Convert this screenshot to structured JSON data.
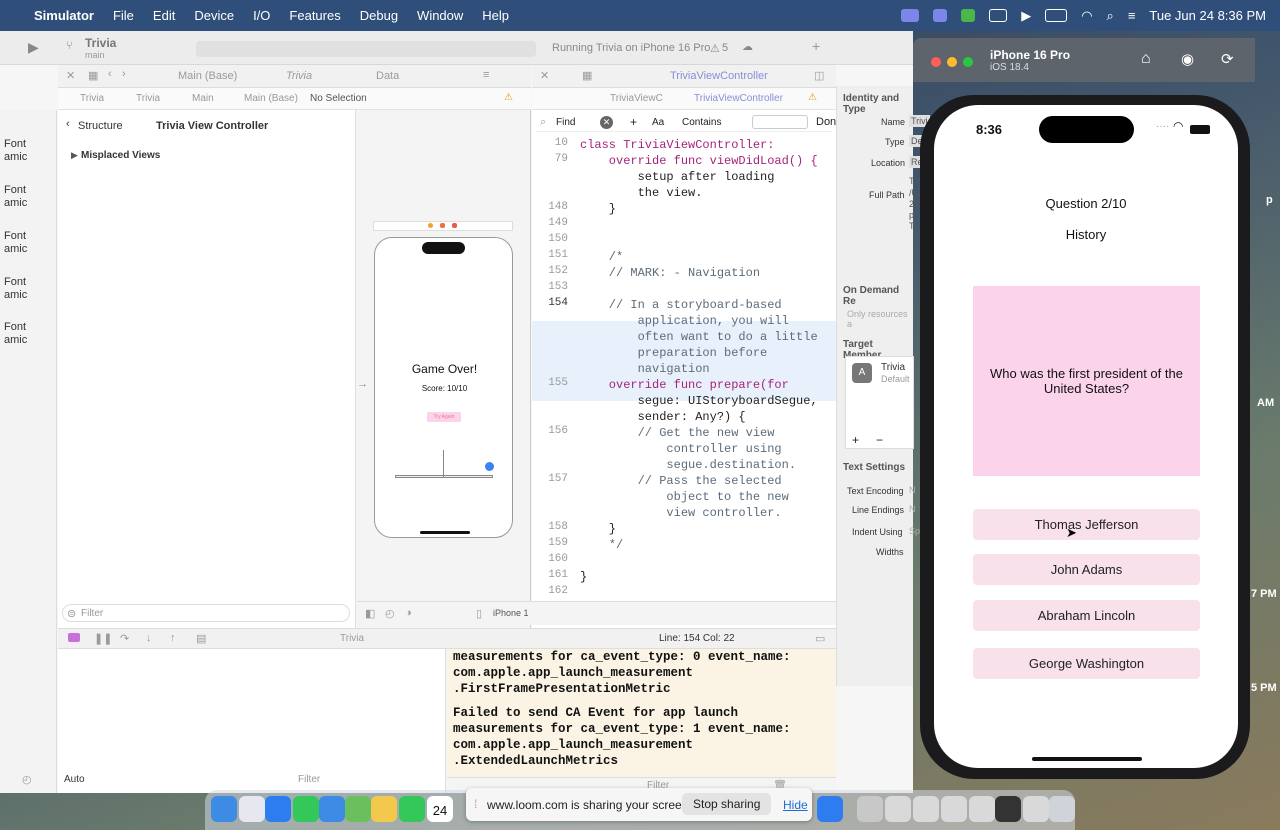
{
  "menubar": {
    "app": "Simulator",
    "items": [
      "File",
      "Edit",
      "Device",
      "I/O",
      "Features",
      "Debug",
      "Window",
      "Help"
    ],
    "datetime": "Tue Jun 24  8:36 PM"
  },
  "xcode": {
    "project": "Trivia",
    "branch": "main",
    "status": "Running Trivia on iPhone 16 Pro",
    "warnings": "5",
    "tabs_left": [
      "Main (Base)",
      "Trivia",
      "Data"
    ],
    "tab_right": "TriviaViewController",
    "jump_left": [
      "Trivia",
      "Trivia",
      "Main",
      "Main (Base)",
      "No Selection"
    ],
    "jump_right": [
      "TriviaViewC",
      "TriviaViewController"
    ],
    "outline_back": "Structure",
    "outline_title": "Trivia View Controller",
    "outline_item": "Misplaced Views",
    "filter_placeholder": "Filter",
    "font_labels": [
      {
        "l1": "Font",
        "l2": "amic"
      },
      {
        "l1": "Font",
        "l2": "amic"
      },
      {
        "l1": "Font",
        "l2": "amic"
      },
      {
        "l1": "Font",
        "l2": "amic"
      },
      {
        "l1": "Font",
        "l2": "amic"
      }
    ],
    "canvas": {
      "title": "Game Over!",
      "score": "Score: 10/10",
      "button": "Try Again",
      "device": "iPhone 1"
    },
    "find": {
      "label": "Find",
      "mode": "Contains",
      "done": "Don",
      "aa": "Aa"
    },
    "code_lines": [
      {
        "num": "10",
        "text": "class TriviaViewController:"
      },
      {
        "num": "79",
        "text": "    override func viewDidLoad() {"
      },
      {
        "num": "",
        "text": "        setup after loading"
      },
      {
        "num": "",
        "text": "        the view."
      },
      {
        "num": "148",
        "text": "    }"
      },
      {
        "num": "149",
        "text": ""
      },
      {
        "num": "150",
        "text": ""
      },
      {
        "num": "151",
        "text": "    /*"
      },
      {
        "num": "152",
        "text": "    // MARK: - Navigation"
      },
      {
        "num": "153",
        "text": ""
      },
      {
        "num": "154",
        "text": "    // In a storyboard-based"
      },
      {
        "num": "",
        "text": "        application, you will"
      },
      {
        "num": "",
        "text": "        often want to do a little"
      },
      {
        "num": "",
        "text": "        preparation before"
      },
      {
        "num": "",
        "text": "        navigation"
      },
      {
        "num": "155",
        "text": "    override func prepare(for"
      },
      {
        "num": "",
        "text": "        segue: UIStoryboardSegue,"
      },
      {
        "num": "",
        "text": "        sender: Any?) {"
      },
      {
        "num": "156",
        "text": "        // Get the new view"
      },
      {
        "num": "",
        "text": "            controller using"
      },
      {
        "num": "",
        "text": "            segue.destination."
      },
      {
        "num": "157",
        "text": "        // Pass the selected"
      },
      {
        "num": "",
        "text": "            object to the new"
      },
      {
        "num": "",
        "text": "            view controller."
      },
      {
        "num": "158",
        "text": "    }"
      },
      {
        "num": "159",
        "text": "    */"
      },
      {
        "num": "160",
        "text": ""
      },
      {
        "num": "161",
        "text": "}"
      },
      {
        "num": "162",
        "text": ""
      }
    ],
    "cursor": "Line: 154  Col: 22",
    "console_lines": [
      "measurements for ca_event_type: 0 event_name:",
      "com.apple.app_launch_measurement",
      ".FirstFramePresentationMetric",
      "",
      "Failed to send CA Event for app launch",
      "measurements for ca_event_type: 1 event_name:",
      "com.apple.app_launch_measurement",
      ".ExtendedLaunchMetrics"
    ],
    "debug_scheme": "Trivia",
    "vars_mode": "Auto",
    "inspector": {
      "header": "Identity and Type",
      "rows": [
        {
          "label": "Name",
          "value": "Trivi"
        },
        {
          "label": "Type",
          "value": "De"
        },
        {
          "label": "Location",
          "value": "Re"
        },
        {
          "label": "Full Path",
          "value": "Triv"
        }
      ],
      "path_extra": [
        "/Us",
        "202",
        "pr",
        "Tri"
      ],
      "on_demand": "On Demand Re",
      "only_resources": "Only resources a",
      "target": "Target Member",
      "target_name": "Trivia",
      "target_sub": "Default",
      "text_settings": "Text Settings",
      "text_rows": [
        "Text Encoding",
        "Line Endings",
        "Indent Using",
        "Widths"
      ],
      "text_values": [
        "N",
        "N",
        "Sp",
        ""
      ]
    }
  },
  "simulator": {
    "device": "iPhone 16 Pro",
    "os": "iOS 18.4",
    "time": "8:36",
    "question_counter": "Question 2/10",
    "category": "History",
    "question": "Who was the first president of the United States?",
    "answers": [
      "Thomas Jefferson",
      "John Adams",
      "Abraham Lincoln",
      "George Washington"
    ]
  },
  "desktop_clock": [
    "AM",
    "7 PM",
    "5 PM",
    "p"
  ],
  "loom": {
    "message": "www.loom.com is sharing your screen.",
    "stop": "Stop sharing",
    "hide": "Hide"
  },
  "dock": {
    "calendar_day": "24"
  },
  "colors": {
    "menubar": "#2f4f7a",
    "answer_bg": "#f9e1ec",
    "question_bg": "#fbd4ec",
    "code_highlight": "#e8f0fb",
    "console_bg": "#fbf4e4"
  }
}
